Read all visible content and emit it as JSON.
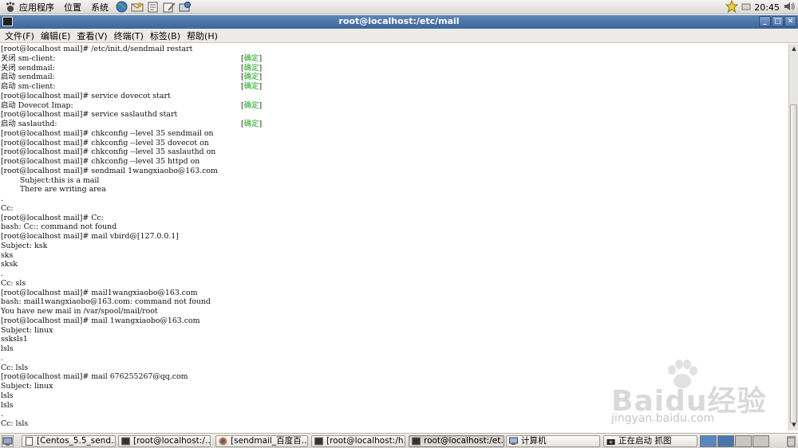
{
  "top_panel": {
    "menus": [
      "应用程序",
      "位置",
      "系统"
    ],
    "launchers": [
      "globe-icon",
      "mail-icon",
      "notes-icon",
      "edit-icon",
      "update-icon"
    ],
    "clock": "20:45",
    "tray": [
      "notification-star-icon",
      "network-icon",
      "volume-icon"
    ]
  },
  "window": {
    "title": "root@localhost:/etc/mail",
    "buttons": [
      "minimize",
      "maximize",
      "close"
    ]
  },
  "menubar": {
    "items": [
      "文件(F)",
      "编辑(E)",
      "查看(V)",
      "终端(T)",
      "标签(B)",
      "帮助(H)"
    ]
  },
  "terminal": {
    "lines": [
      {
        "text": "[root@localhost mail]# /etc/init.d/sendmail restart"
      },
      {
        "text": "关闭 sm-client:",
        "status": "确定"
      },
      {
        "text": "关闭 sendmail:",
        "status": "确定"
      },
      {
        "text": "启动 sendmail:",
        "status": "确定"
      },
      {
        "text": "启动 sm-client:",
        "status": "确定"
      },
      {
        "text": "[root@localhost mail]# service dovecot start"
      },
      {
        "text": "启动 Dovecot Imap:",
        "status": "确定"
      },
      {
        "text": "[root@localhost mail]# service saslauthd start"
      },
      {
        "text": "启动 saslauthd:",
        "status": "确定"
      },
      {
        "text": "[root@localhost mail]# chkconfig --level 35 sendmail on"
      },
      {
        "text": "[root@localhost mail]# chkconfig --level 35 dovecot on"
      },
      {
        "text": "[root@localhost mail]# chkconfig --level 35 saslauthd on"
      },
      {
        "text": "[root@localhost mail]# chkconfig --level 35 httpd on"
      },
      {
        "text": "[root@localhost mail]# sendmail 1wangxiaobo@163.com"
      },
      {
        "text": "        Subject:this is a mail"
      },
      {
        "text": "        There are writing area"
      },
      {
        "text": "."
      },
      {
        "text": "Cc:"
      },
      {
        "text": "[root@localhost mail]# Cc:"
      },
      {
        "text": "bash: Cc:: command not found"
      },
      {
        "text": "[root@localhost mail]# mail vbird@[127.0.0.1]"
      },
      {
        "text": "Subject: ksk"
      },
      {
        "text": "sks"
      },
      {
        "text": "sksk"
      },
      {
        "text": "."
      },
      {
        "text": "Cc: sls"
      },
      {
        "text": "[root@localhost mail]# mail1wangxiaobo@163.com"
      },
      {
        "text": "bash: mail1wangxiaobo@163.com: command not found"
      },
      {
        "text": "You have new mail in /var/spool/mail/root"
      },
      {
        "text": "[root@localhost mail]# mail 1wangxiaobo@163.com"
      },
      {
        "text": "Subject: linux"
      },
      {
        "text": "ssksls1"
      },
      {
        "text": "lsls"
      },
      {
        "text": "."
      },
      {
        "text": "Cc: lsls"
      },
      {
        "text": "[root@localhost mail]# mail 676255267@qq.com"
      },
      {
        "text": "Subject: linux"
      },
      {
        "text": "lsls"
      },
      {
        "text": "lsls"
      },
      {
        "text": "."
      },
      {
        "text": "Cc: lsls"
      }
    ]
  },
  "watermark": {
    "main": "Baidu经验",
    "url": "jingyan.baidu.com"
  },
  "taskbar": {
    "tasks": [
      {
        "label": "[Centos_5.5_send…",
        "icon": "document-icon"
      },
      {
        "label": "[root@localhost:/…",
        "icon": "terminal-icon"
      },
      {
        "label": "[sendmail_百度百…",
        "icon": "firefox-icon"
      },
      {
        "label": "[root@localhost:/h…",
        "icon": "terminal-icon"
      },
      {
        "label": "root@localhost:/et…",
        "icon": "terminal-icon",
        "active": true
      },
      {
        "label": "计算机",
        "icon": "computer-icon"
      },
      {
        "label": "正在启动 抓图",
        "icon": "camera-icon"
      }
    ]
  },
  "colors": {
    "titlebar": "#3b6598",
    "ok_status": "#1aa31a"
  }
}
